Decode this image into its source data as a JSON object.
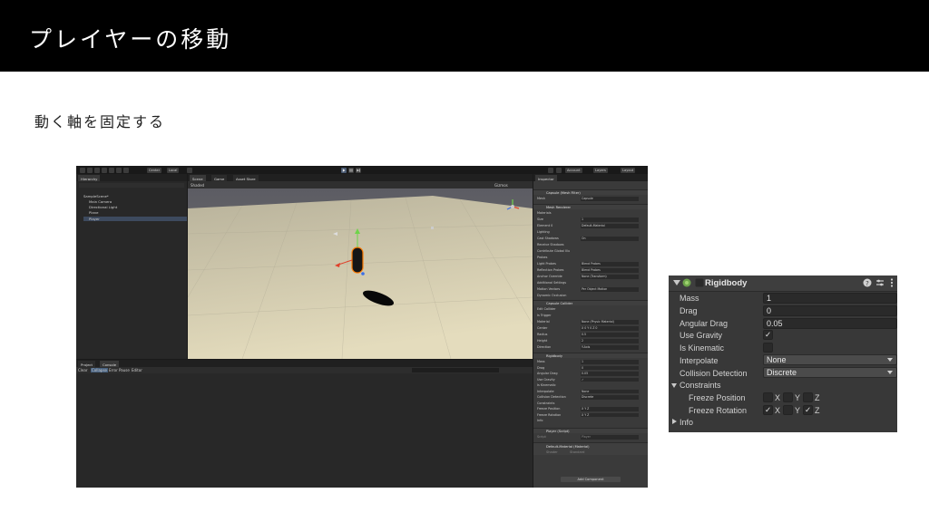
{
  "slide": {
    "title": "プレイヤーの移動",
    "subtitle": "動く軸を固定する"
  },
  "editor": {
    "toolbar": {
      "pivot": "Center",
      "space": "Local",
      "account": "Account",
      "layers": "Layers",
      "layout": "Layout"
    },
    "hierarchy": {
      "tab": "Hierarchy",
      "items": [
        "SampleScene*",
        "Main Camera",
        "Directional Light",
        "Plane",
        "Player"
      ]
    },
    "scene": {
      "tabs": [
        "Scene",
        "Game",
        "Asset Store"
      ],
      "shading": "Shaded",
      "gizmos": "Gizmos"
    },
    "project": {
      "tabs": [
        "Project",
        "Console"
      ],
      "buttons": [
        "Clear",
        "Collapse",
        "Error Pause",
        "Editor"
      ]
    },
    "inspector": {
      "tab": "Inspector",
      "mesh_filter": "Capsule (Mesh Filter)",
      "mesh_label": "Mesh",
      "mesh_value": "Capsule",
      "mesh_renderer": "Mesh Renderer",
      "renderer_rows": [
        {
          "label": "Materials",
          "value": ""
        },
        {
          "label": "Size",
          "value": "1"
        },
        {
          "label": "Element 0",
          "value": "Default-Material"
        },
        {
          "label": "Lighting",
          "value": ""
        },
        {
          "label": "Cast Shadows",
          "value": "On"
        },
        {
          "label": "Receive Shadows",
          "value": ""
        },
        {
          "label": "Contribute Global Illu",
          "value": ""
        },
        {
          "label": "Probes",
          "value": ""
        },
        {
          "label": "Light Probes",
          "value": "Blend Probes"
        },
        {
          "label": "Reflection Probes",
          "value": "Blend Probes"
        },
        {
          "label": "Anchor Override",
          "value": "None (Transform)"
        },
        {
          "label": "Additional Settings",
          "value": ""
        },
        {
          "label": "Motion Vectors",
          "value": "Per Object Motion"
        },
        {
          "label": "Dynamic Occlusion",
          "value": ""
        }
      ],
      "collider": "Capsule Collider",
      "collider_rows": [
        {
          "label": "Edit Collider",
          "value": ""
        },
        {
          "label": "Is Trigger",
          "value": ""
        },
        {
          "label": "Material",
          "value": "None (Physic Material)"
        },
        {
          "label": "Center",
          "value": "X 0  Y 0  Z 0"
        },
        {
          "label": "Radius",
          "value": "0.5"
        },
        {
          "label": "Height",
          "value": "2"
        },
        {
          "label": "Direction",
          "value": "Y-Axis"
        }
      ],
      "rigidbody": "Rigidbody",
      "rigidbody_rows": [
        {
          "label": "Mass",
          "value": "1"
        },
        {
          "label": "Drag",
          "value": "0"
        },
        {
          "label": "Angular Drag",
          "value": "0.05"
        },
        {
          "label": "Use Gravity",
          "value": "✓"
        },
        {
          "label": "Is Kinematic",
          "value": ""
        },
        {
          "label": "Interpolate",
          "value": "None"
        },
        {
          "label": "Collision Detection",
          "value": "Discrete"
        },
        {
          "label": "Constraints",
          "value": ""
        },
        {
          "label": "Freeze Position",
          "value": "X  Y  Z"
        },
        {
          "label": "Freeze Rotation",
          "value": "X  Y  Z"
        },
        {
          "label": "Info",
          "value": ""
        }
      ],
      "script": "Player (Script)",
      "script_label": "Script",
      "script_value": "Player",
      "material": "Default-Material (Material)",
      "shader_label": "Shader",
      "shader_value": "Standard",
      "add_component": "Add Component"
    }
  },
  "rigidbody_panel": {
    "title": "Rigidbody",
    "mass_label": "Mass",
    "mass_value": "1",
    "drag_label": "Drag",
    "drag_value": "0",
    "angular_drag_label": "Angular Drag",
    "angular_drag_value": "0.05",
    "use_gravity_label": "Use Gravity",
    "use_gravity": "✓",
    "is_kinematic_label": "Is Kinematic",
    "is_kinematic": "",
    "interpolate_label": "Interpolate",
    "interpolate_value": "None",
    "collision_detection_label": "Collision Detection",
    "collision_detection_value": "Discrete",
    "constraints_label": "Constraints",
    "freeze_position_label": "Freeze Position",
    "freeze_position": {
      "x": "",
      "y": "",
      "z": ""
    },
    "freeze_rotation_label": "Freeze Rotation",
    "freeze_rotation": {
      "x": "✓",
      "y": "",
      "z": "✓"
    },
    "axis_x": "X",
    "axis_y": "Y",
    "axis_z": "Z",
    "info_label": "Info"
  },
  "colors": {
    "title_bg": "#000000",
    "editor_bg": "#282828",
    "panel_bg": "#383838",
    "selection": "#3d4a5e",
    "player_outline": "#ff7a00"
  }
}
